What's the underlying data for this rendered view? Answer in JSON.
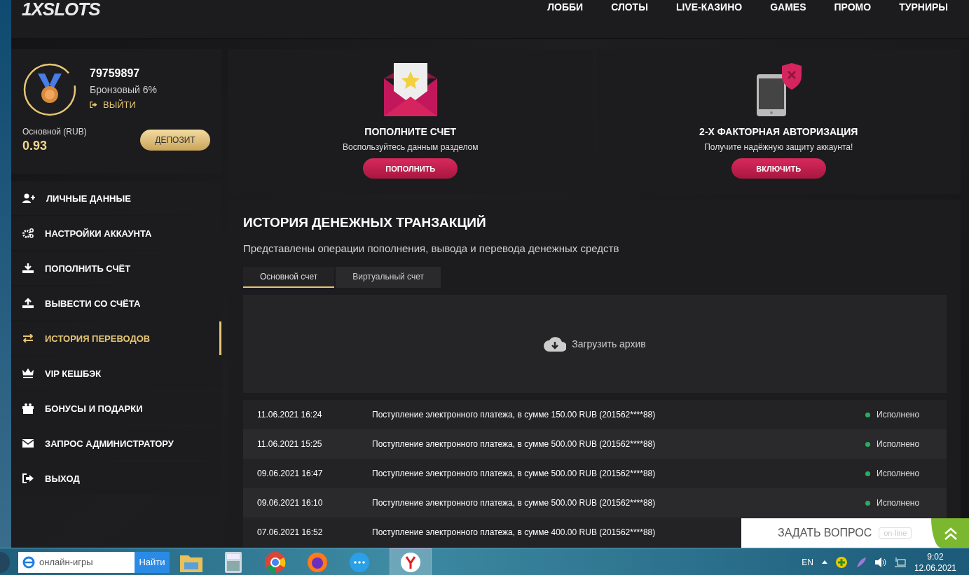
{
  "header": {
    "logo": "1XSLOTS",
    "nav": [
      {
        "label": "ЛОББИ"
      },
      {
        "label": "СЛОТЫ"
      },
      {
        "label": "LIVE-КАЗИНО"
      },
      {
        "label": "GAMES"
      },
      {
        "label": "ПРОМО"
      },
      {
        "label": "ТУРНИРЫ"
      }
    ]
  },
  "profile": {
    "account_id": "79759897",
    "level": "Бронзовый 6%",
    "logout": "ВЫЙТИ",
    "balance_label": "Основной (RUB)",
    "balance": "0.93",
    "deposit_button": "ДЕПОЗИТ"
  },
  "sidebar": {
    "items": [
      {
        "label": "ЛИЧНЫЕ ДАННЫЕ",
        "selected": false
      },
      {
        "label": "НАСТРОЙКИ АККАУНТА",
        "selected": false
      },
      {
        "label": "ПОПОЛНИТЬ СЧЁТ",
        "selected": false
      },
      {
        "label": "ВЫВЕСТИ СО СЧЁТА",
        "selected": false
      },
      {
        "label": "ИСТОРИЯ ПЕРЕВОДОВ",
        "selected": true
      },
      {
        "label": "VIP КЕШБЭК",
        "selected": false
      },
      {
        "label": "БОНУСЫ И ПОДАРКИ",
        "selected": false
      },
      {
        "label": "ЗАПРОС АДМИНИСТРАТОРУ",
        "selected": false
      },
      {
        "label": "ВЫХОД",
        "selected": false
      }
    ]
  },
  "promo_cards": [
    {
      "kind": "deposit",
      "title": "ПОПОЛНИТЕ СЧЕТ",
      "subtitle": "Воспользуйтесь данным разделом",
      "button": "ПОПОЛНИТЬ"
    },
    {
      "kind": "security",
      "title": "2-Х ФАКТОРНАЯ АВТОРИЗАЦИЯ",
      "subtitle": "Получите надёжную защиту аккаунта!",
      "button": "ВКЛЮЧИТЬ"
    }
  ],
  "history": {
    "title": "ИСТОРИЯ ДЕНЕЖНЫХ ТРАНЗАКЦИЙ",
    "description": "Представлены операции пополнения, вывода и перевода денежных средств",
    "tabs": [
      {
        "label": "Основной счет",
        "selected": true
      },
      {
        "label": "Виртуальный счет",
        "selected": false
      }
    ],
    "archive_button": "Загрузить архив",
    "rows": [
      {
        "date": "11.06.2021 16:24",
        "description": "Поступление электронного платежа, в сумме 150.00 RUB (201562****88)",
        "status": "Исполнено"
      },
      {
        "date": "11.06.2021 15:25",
        "description": "Поступление электронного платежа, в сумме 500.00 RUB (201562****88)",
        "status": "Исполнено"
      },
      {
        "date": "09.06.2021 16:47",
        "description": "Поступление электронного платежа, в сумме 500.00 RUB (201562****88)",
        "status": "Исполнено"
      },
      {
        "date": "09.06.2021 16:10",
        "description": "Поступление электронного платежа, в сумме 500.00 RUB (201562****88)",
        "status": "Исполнено"
      },
      {
        "date": "07.06.2021 16:52",
        "description": "Поступление электронного платежа, в сумме 400.00 RUB (201562****88)"
      }
    ]
  },
  "chat_widget": {
    "label": "ЗАДАТЬ ВОПРОС",
    "badge": "on-line"
  },
  "taskbar": {
    "search": {
      "value": "онлайн-игры",
      "button": "Найти"
    },
    "language": "EN",
    "time": "9:02",
    "date": "12.06.2021"
  }
}
